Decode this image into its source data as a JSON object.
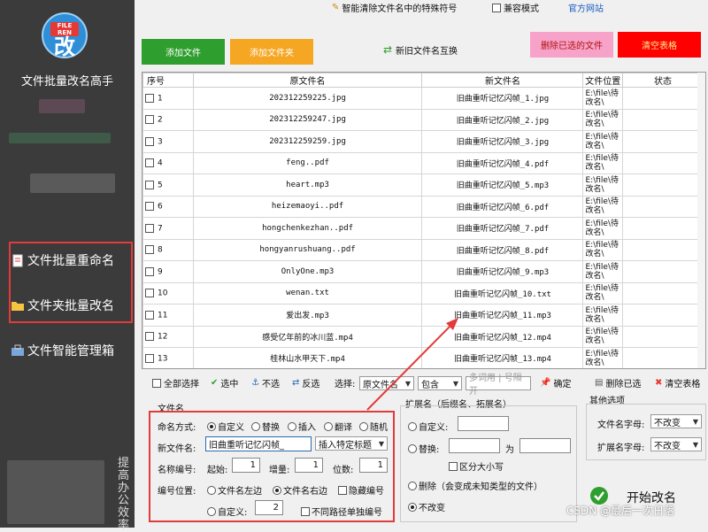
{
  "app": {
    "title": "文件批量改名高手",
    "logo_banner": "FILE REN",
    "logo_glyph": "改"
  },
  "sidebar": {
    "items": [
      {
        "label": "文件批量重命名",
        "icon": "document-icon"
      },
      {
        "label": "文件夹批量改名",
        "icon": "folder-icon"
      },
      {
        "label": "文件智能管理箱",
        "icon": "toolbox-icon"
      }
    ],
    "vertical_text": "提高办公效率"
  },
  "topbar": {
    "special_chars": "智能清除文件名中的特殊符号",
    "compat_mode": "兼容模式",
    "official_site": "官方网站"
  },
  "actions": {
    "add_files": "添加文件",
    "add_folder": "添加文件夹",
    "swap_names": "新旧文件名互换",
    "delete_selected": "删除已选的文件",
    "clear_table": "清空表格"
  },
  "colors": {
    "add_files": "#2e9e2e",
    "add_folder": "#f5a623",
    "delete_selected": "#f7a2c8",
    "clear_table": "#ff0000",
    "sidebar": "#3b3b3b",
    "highlight": "#e23b3b"
  },
  "table": {
    "headers": [
      "序号",
      "原文件名",
      "新文件名",
      "文件位置",
      "状态"
    ],
    "rows": [
      {
        "no": "1",
        "orig": "202312259225.jpg",
        "new": "旧曲重听记忆闪帧_1.jpg",
        "loc": "E:\\file\\待改名\\",
        "status": ""
      },
      {
        "no": "2",
        "orig": "202312259247.jpg",
        "new": "旧曲重听记忆闪帧_2.jpg",
        "loc": "E:\\file\\待改名\\",
        "status": ""
      },
      {
        "no": "3",
        "orig": "202312259259.jpg",
        "new": "旧曲重听记忆闪帧_3.jpg",
        "loc": "E:\\file\\待改名\\",
        "status": ""
      },
      {
        "no": "4",
        "orig": "feng..pdf",
        "new": "旧曲重听记忆闪帧_4.pdf",
        "loc": "E:\\file\\待改名\\",
        "status": ""
      },
      {
        "no": "5",
        "orig": "heart.mp3",
        "new": "旧曲重听记忆闪帧_5.mp3",
        "loc": "E:\\file\\待改名\\",
        "status": ""
      },
      {
        "no": "6",
        "orig": "heizemaoyi..pdf",
        "new": "旧曲重听记忆闪帧_6.pdf",
        "loc": "E:\\file\\待改名\\",
        "status": ""
      },
      {
        "no": "7",
        "orig": "hongchenkezhan..pdf",
        "new": "旧曲重听记忆闪帧_7.pdf",
        "loc": "E:\\file\\待改名\\",
        "status": ""
      },
      {
        "no": "8",
        "orig": "hongyanrushuang..pdf",
        "new": "旧曲重听记忆闪帧_8.pdf",
        "loc": "E:\\file\\待改名\\",
        "status": ""
      },
      {
        "no": "9",
        "orig": "OnlyOne.mp3",
        "new": "旧曲重听记忆闪帧_9.mp3",
        "loc": "E:\\file\\待改名\\",
        "status": ""
      },
      {
        "no": "10",
        "orig": "wenan.txt",
        "new": "旧曲重听记忆闪帧_10.txt",
        "loc": "E:\\file\\待改名\\",
        "status": ""
      },
      {
        "no": "11",
        "orig": "爱出发.mp3",
        "new": "旧曲重听记忆闪帧_11.mp3",
        "loc": "E:\\file\\待改名\\",
        "status": ""
      },
      {
        "no": "12",
        "orig": "感受亿年前的冰川蓝.mp4",
        "new": "旧曲重听记忆闪帧_12.mp4",
        "loc": "E:\\file\\待改名\\",
        "status": ""
      },
      {
        "no": "13",
        "orig": "桂林山水甲天下.mp4",
        "new": "旧曲重听记忆闪帧_13.mp4",
        "loc": "E:\\file\\待改名\\",
        "status": ""
      }
    ]
  },
  "selection_bar": {
    "select_all": "全部选择",
    "check": "选中",
    "uncheck": "不选",
    "invert": "反选",
    "select_label": "选择:",
    "field": "原文件名",
    "mode": "包含",
    "keyword_placeholder": "多词用 | 号隔开",
    "confirm": "确定",
    "delete_checked": "删除已选",
    "clear_table": "清空表格"
  },
  "filename_panel": {
    "title": "文件名",
    "method_label": "命名方式:",
    "methods": [
      "自定义",
      "替换",
      "插入",
      "翻译",
      "随机"
    ],
    "newname_label": "新文件名:",
    "newname_value": "旧曲重听记忆闪帧_",
    "insert_title": "插入特定标题",
    "number_label": "名称编号:",
    "start_label": "起始:",
    "start_value": "1",
    "step_label": "增量:",
    "step_value": "1",
    "digits_label": "位数:",
    "digits_value": "1",
    "pos_label": "编号位置:",
    "pos_left": "文件名左边",
    "pos_right": "文件名右边",
    "hide_number": "隐藏编号",
    "custom_label": "自定义:",
    "custom_value": "2",
    "separate_path": "不同路径单独编号"
  },
  "ext_panel": {
    "title": "扩展名（后缀名、拓展名）",
    "custom": "自定义:",
    "replace": "替换:",
    "to": "为",
    "case": "区分大小写",
    "delete": "删除（会变成未知类型的文件）",
    "nochange": "不改变"
  },
  "other_panel": {
    "title": "其他选项",
    "name_case_label": "文件名字母:",
    "name_case_value": "不改变",
    "ext_case_label": "扩展名字母:",
    "ext_case_value": "不改变"
  },
  "start_button": "开始改名",
  "watermark": "CSDN @最后一次日落"
}
